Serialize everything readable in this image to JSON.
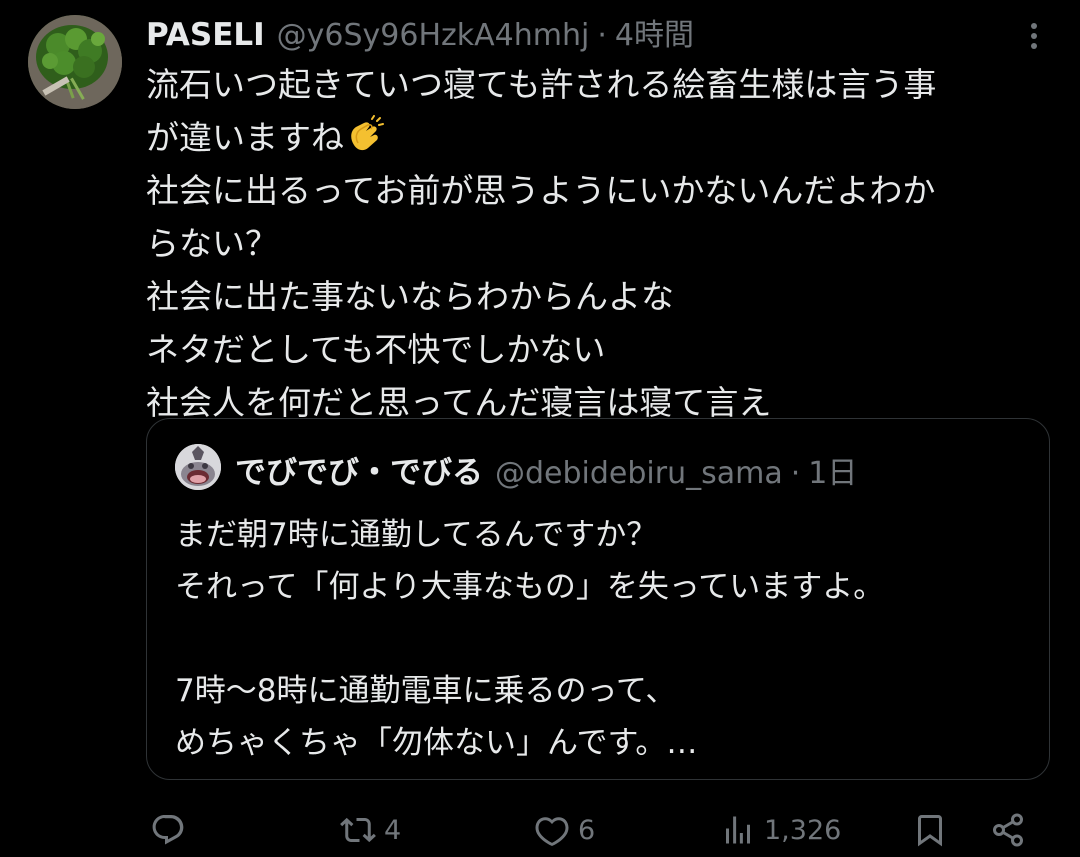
{
  "tweet": {
    "display_name": "PASELI",
    "handle": "@y6Sy96HzkA4hmhj",
    "separator": "·",
    "time": "4時間",
    "avatar_icon": "parsley-photo-avatar",
    "lines": [
      "流石いつ起きていつ寝ても許される絵畜生様は言う事",
      "が違いますね",
      "社会に出るってお前が思うようにいかないんだよわか",
      "らない？",
      "社会に出た事ないならわからんよな",
      "ネタだとしても不快でしかない",
      "社会人を何だと思ってんだ寝言は寝て言え"
    ],
    "emoji": "clapping-hands-emoji"
  },
  "quote": {
    "display_name": "でびでび・でびる",
    "handle": "@debidebiru_sama",
    "separator": "·",
    "time": "1日",
    "avatar_icon": "character-avatar",
    "lines": [
      "まだ朝7時に通勤してるんですか？",
      "それって「何より大事なもの」を失っていますよ。",
      "",
      "7時〜8時に通勤電車に乗るのって、",
      "めちゃくちゃ「勿体ない」んです。…"
    ]
  },
  "actions": {
    "reply_count": "",
    "retweet_count": "4",
    "like_count": "6",
    "views_count": "1,326"
  },
  "colors": {
    "background": "#000000",
    "text_primary": "#e7e9ea",
    "text_secondary": "#71767b",
    "border": "#2f3336"
  }
}
